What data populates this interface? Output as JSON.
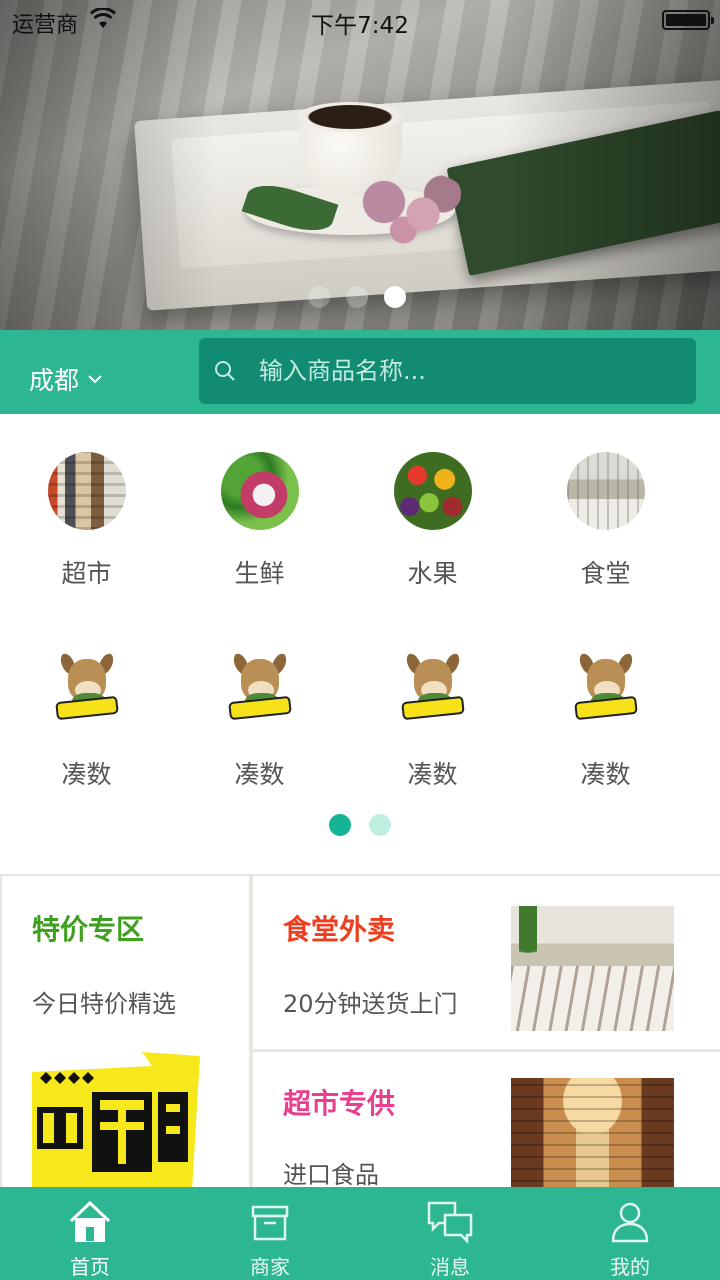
{
  "status_bar": {
    "carrier": "运营商",
    "time": "下午7:42",
    "battery_level": 1.0
  },
  "banner": {
    "slide_count": 3,
    "active_slide": 3
  },
  "search": {
    "city": "成都",
    "placeholder": "输入商品名称..."
  },
  "categories": {
    "items": [
      {
        "label": "超市",
        "icon": "supermarket-photo"
      },
      {
        "label": "生鲜",
        "icon": "fresh-produce-photo"
      },
      {
        "label": "水果",
        "icon": "fruit-photo"
      },
      {
        "label": "食堂",
        "icon": "canteen-photo"
      },
      {
        "label": "凑数",
        "icon": "donkey-mascot"
      },
      {
        "label": "凑数",
        "icon": "donkey-mascot"
      },
      {
        "label": "凑数",
        "icon": "donkey-mascot"
      },
      {
        "label": "凑数",
        "icon": "donkey-mascot"
      }
    ],
    "page_count": 2,
    "active_page": 1
  },
  "promos": {
    "left": {
      "title": "特价专区",
      "subtitle": "今日特价精选",
      "title_color": "#3f9f1f",
      "graphic": "today-special-graphic"
    },
    "right_top": {
      "title": "食堂外卖",
      "subtitle": "20分钟送货上门",
      "title_color": "#ef3e1e",
      "image": "canteen-photo"
    },
    "right_bottom": {
      "title": "超市专供",
      "subtitle": "进口食品",
      "title_color": "#ea3f8f",
      "image": "supermarket-aisle-photo"
    }
  },
  "tabbar": {
    "items": [
      {
        "label": "首页",
        "icon": "home-icon",
        "active": true
      },
      {
        "label": "商家",
        "icon": "store-icon",
        "active": false
      },
      {
        "label": "消息",
        "icon": "message-icon",
        "active": false
      },
      {
        "label": "我的",
        "icon": "user-icon",
        "active": false
      }
    ]
  },
  "colors": {
    "accent": "#2cb691",
    "search_box": "#118b72",
    "dot_active": "#15b495",
    "dot_inactive": "#bfeee3"
  }
}
